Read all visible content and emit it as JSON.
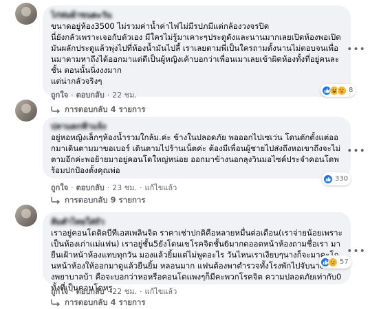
{
  "colors": {
    "bubble_bg": "#f0f2f5",
    "meta_text": "#65676b",
    "like_blue": "#1877f2",
    "emoji_yellow": "#f7b928"
  },
  "comments": [
    {
      "author": "ไก่ห่มผ้าขนตะวัน",
      "text": "ขนาดอยู่ห้อง3500 ไม่รวมค่าน้ำค่าไฟไม่มีรปภมีแต่กล้องวงจรปิด\nนี่ยังกลัวเพราะเจอกับตัวเอง มีใครไม่รู้มาเคาะๆประตูดังและนานมากเลยเปิดห้องพอเปิดมันผลักประตูแล้วพุ่งไปที่ห้องน้ำมันไปลี้ เราเลยตามพี่เป็นใครถามตั้งนานไม่ตอบจนเพื่อนมาตามหาถึงได้ออกมาแต่ดีเป็นผู้หญิงเค้าบอกว่าเพื่อนเมาเลยเข้าผิดห้องทั้งที่อยู่คนละชั้น ตอนนั้นนิ่งงงมาก\nแต่น่ากลัวจริงๆ",
      "reaction_icons": [
        "like-icon",
        "haha-icon",
        "care-icon"
      ],
      "reaction_count": "8",
      "like_label": "ถูกใจ",
      "reply_label": "ตอบกลับ",
      "time": "22 ชม.",
      "edited": "",
      "replies_label": "การตอบกลับ 4 รายการ"
    },
    {
      "author": "ปลาแดกฟ้าแจ้ง",
      "text": "อยู่หอหญิงเล็กๆห้องน้ำรวมใกล้ม.ค่ะ ข้างในปลอดภัย พอออกไปเซเว่น โดนตักตั้งแต่ออกมาเดินตามมาขอเบอร์ เดินตามไปร้านเน็ตค่ะ ต้องมีเพื่อนผู้ชายไปส่งถึงหอเขาถึงจะไม่ตามอีกค่ะพอย้ายมาอยู่คอนโดใหญ่หน่อย ออกมาข้างนอกลุงวินมอไซค์ประจำคอนโดพร้อมปกป้องตั้งคุณพ่อ",
      "reaction_icons": [
        "like-icon"
      ],
      "reaction_count": "330",
      "like_label": "ถูกใจ",
      "reply_label": "ตอบกลับ",
      "time": "23 ชม.",
      "edited": "แก้ไขแล้ว",
      "replies_label": "การตอบกลับ 9 รายการ"
    },
    {
      "author": "ส้มตำไทยใส่ถั่ว",
      "text": "เราอยู่คอนโดติดบีทีเอสเพลินจิต ราคาเช่าปกติคือหลายหมื่นต่อเดือน(เราจ่ายน้อยเพราะเป็นห้องเก่าแม่แฟน) เราอยู่ชั้น5ยังโดนเขโรคจิตชั้น6มากดออดหน้าห้องถามชื่อเรา มายืนเฝ้าหน้าห้องแทบทุกวัน มองแล้วยิ้มแต่ไม่พูดอะไร วันไหนเราเงียบๆนางก็จะมาคะโกนหน้าห้องให้ออกมาดูแล้วยืนยิ้ม หลอนมาก แฟนต้องพาตำรวจทั้งโรงพักไปจับนางไปโรงพยาบาลบ้า คือจะบอกว่าหอหรือคอนโดแพงๆก็มีคะพวกโรคจิต ความปลอดภัยเท่ากับ0ทั้งที่เป็นคอนโดหรู",
      "reaction_icons": [
        "like-icon",
        "sad-icon"
      ],
      "reaction_count": "57",
      "like_label": "ถูกใจ",
      "reply_label": "ตอบกลับ",
      "time": "22 ชม.",
      "edited": "แก้ไขแล้ว",
      "replies_label": "การตอบกลับ 4 รายการ"
    }
  ]
}
